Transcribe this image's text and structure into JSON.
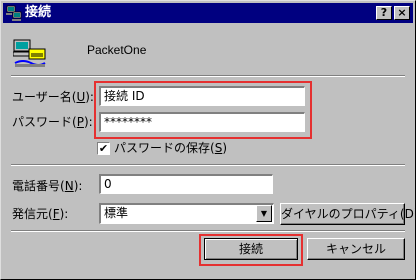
{
  "window": {
    "title": "接続",
    "help_label": "?",
    "close_label": "×"
  },
  "connection": {
    "name": "PacketOne"
  },
  "form": {
    "username_label": "ユーザー名",
    "username_accel": "U",
    "username_value": "接続 ID",
    "password_label": "パスワード",
    "password_accel": "P",
    "password_value": "********",
    "save_password_label": "パスワードの保存",
    "save_password_accel": "S",
    "save_password_checked": true,
    "save_password_mark": "✔",
    "phone_label": "電話番号",
    "phone_accel": "N",
    "phone_value": "0",
    "dial_from_label": "発信元",
    "dial_from_accel": "F",
    "dial_from_value": "標準",
    "dial_props_label": "ダイヤルのプロパティ(D)..."
  },
  "buttons": {
    "connect_label": "接続",
    "cancel_label": "キャンセル"
  },
  "colors": {
    "titlebar": "#000080",
    "face": "#c0c0c0",
    "highlight_annotation": "#e53030"
  },
  "icons": {
    "title": "network-computers-icon",
    "connection": "dialup-connection-icon",
    "dropdown": "down-arrow-icon"
  }
}
